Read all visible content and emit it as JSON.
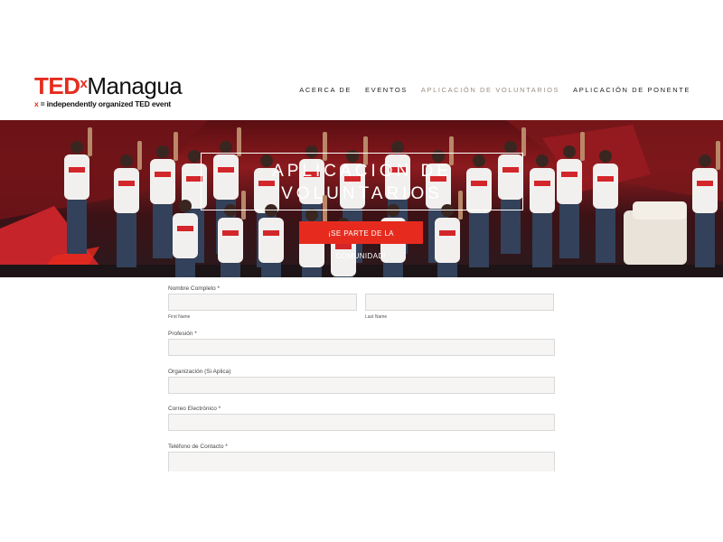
{
  "header": {
    "logo_ted": "TED",
    "logo_x": "x",
    "logo_city": "Managua",
    "logo_tagline_x": "x",
    "logo_tagline": " = independently organized TED event",
    "nav": [
      {
        "label": "ACERCA DE",
        "active": false
      },
      {
        "label": "EVENTOS",
        "active": false
      },
      {
        "label": "APLICACIÓN DE VOLUNTARIOS",
        "active": true
      },
      {
        "label": "APLICACIÓN DE PONENTE",
        "active": false
      }
    ]
  },
  "hero": {
    "title_line1": "APLICACIÓN DE",
    "title_line2": "VOLUNTARIOS",
    "cta_label": "¡SE PARTE DE LA COMUNIDAD!"
  },
  "form": {
    "full_name_label": "Nombre Completo *",
    "first_name_sublabel": "First Name",
    "last_name_sublabel": "Last Name",
    "profession_label": "Profesión *",
    "organization_label": "Organización (Si Aplica)",
    "email_label": "Correo Electrónico *",
    "phone_label": "Teléfono de Contacto *"
  },
  "colors": {
    "brand_red": "#e62b1e",
    "nav_active": "#9a8f84",
    "input_bg": "#f6f5f3"
  }
}
